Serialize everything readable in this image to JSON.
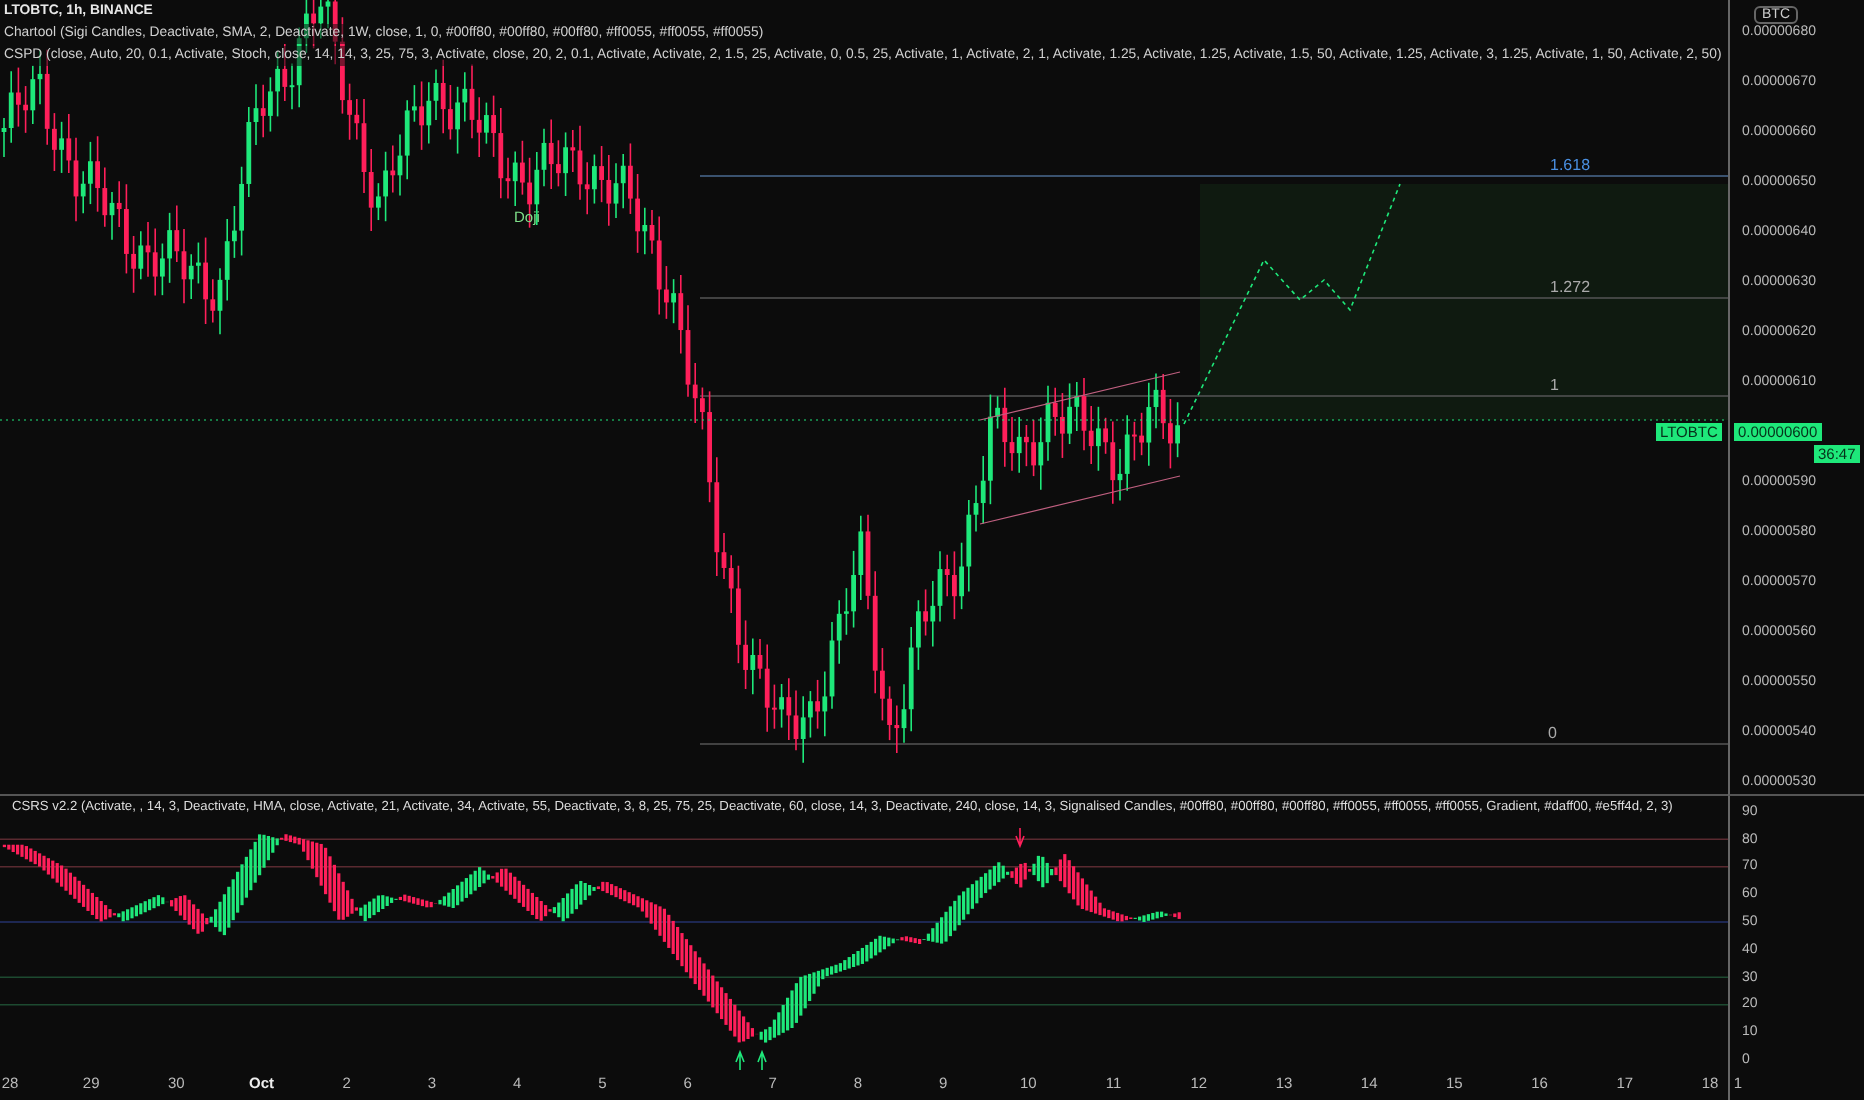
{
  "symbol_title": "LTOBTC, 1h, BINANCE",
  "indicator_legends": [
    "Chartool (Sigi Candles, Deactivate, SMA, 2, Deactivate, 1W, close, 1, 0, #00ff80, #00ff80, #00ff80, #ff0055, #ff0055, #ff0055)",
    "CSPD (close, Auto, 20, 0.1, Activate, Stoch, close, 14, 14, 3, 25, 75, 3, Activate, close, 20, 2, 0.1, Activate, Activate, 2, 1.5, 25, Activate, 0, 0.5, 25, Activate, 1, Activate, 2, 1, Activate, 1.25, Activate, 1.25, Activate, 1.5, 50, Activate, 1.25, Activate, 3, 1.25, Activate, 1, 50, Activate, 2, 50)"
  ],
  "currency_badge": "BTC",
  "price_axis": [
    "0.00000680",
    "0.00000670",
    "0.00000660",
    "0.00000650",
    "0.00000640",
    "0.00000630",
    "0.00000620",
    "0.00000610",
    "0.00000590",
    "0.00000580",
    "0.00000570",
    "0.00000560",
    "0.00000550",
    "0.00000540",
    "0.00000530"
  ],
  "last_price": {
    "symbol": "LTOBTC",
    "price": "0.00000600",
    "countdown": "36:47"
  },
  "fib_levels": [
    "1.618",
    "1.272",
    "1",
    "0"
  ],
  "pattern_labels": [
    "Doji"
  ],
  "oscillator_legend": "CSRS v2.2 (Activate, , 14, 3, Deactivate, HMA, close, Activate, 21, Activate, 34, Activate, 55, Deactivate, 3, 8, 25, 75, 25, Deactivate, 60, close, 14, 3, Deactivate, 240, close, 14, 3, Signalised Candles, #00ff80, #00ff80, #00ff80, #ff0055, #ff0055, #ff0055, Gradient, #daff00, #e5ff4d, 2, 3)",
  "oscillator_axis": [
    "90",
    "80",
    "70",
    "60",
    "50",
    "40",
    "30",
    "20",
    "10",
    "0"
  ],
  "time_axis": [
    "28",
    "29",
    "30",
    "Oct",
    "2",
    "3",
    "4",
    "5",
    "6",
    "7",
    "8",
    "9",
    "10",
    "11",
    "12",
    "13",
    "14",
    "15",
    "16",
    "17",
    "18"
  ],
  "time_axis_corner": "1"
}
